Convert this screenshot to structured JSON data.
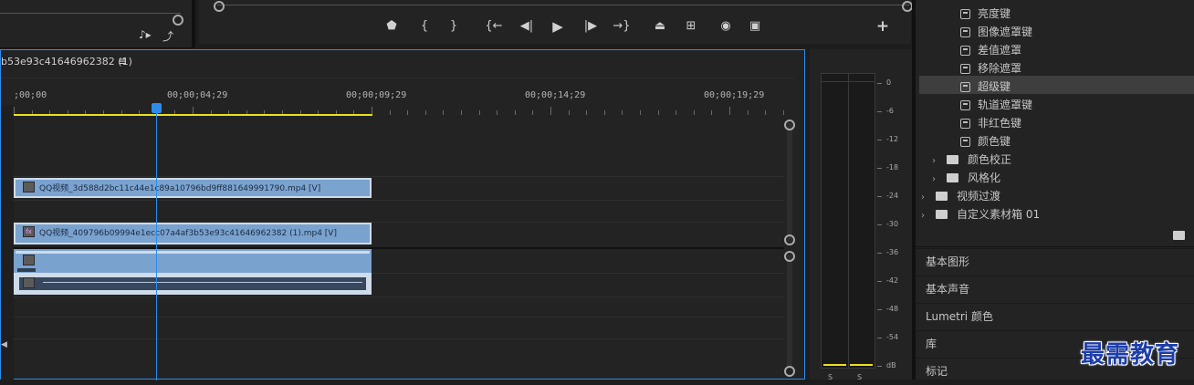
{
  "source_panel": {
    "icons": [
      "insert-icon",
      "export-frame-icon"
    ]
  },
  "program_monitor": {
    "controls": [
      {
        "name": "add-marker-button",
        "glyph": "⬟"
      },
      {
        "name": "mark-in-button",
        "glyph": "{"
      },
      {
        "name": "mark-out-button",
        "glyph": "}"
      },
      {
        "name": "go-to-in-button",
        "glyph": "{←"
      },
      {
        "name": "step-back-button",
        "glyph": "◀|"
      },
      {
        "name": "play-button",
        "glyph": "▶"
      },
      {
        "name": "step-forward-button",
        "glyph": "|▶"
      },
      {
        "name": "go-to-out-button",
        "glyph": "→}"
      },
      {
        "name": "lift-button",
        "glyph": "⏏"
      },
      {
        "name": "extract-button",
        "glyph": "⊞"
      },
      {
        "name": "export-frame-button",
        "glyph": "◉"
      },
      {
        "name": "compare-view-button",
        "glyph": "▣"
      },
      {
        "name": "button-editor-button",
        "glyph": "+"
      }
    ]
  },
  "timeline": {
    "sequence_name": "b53e93c41646962382 (1)",
    "menu_glyph": "≡",
    "ruler_labels": [
      ";00;00",
      "00;00;04;29",
      "00;00;09;29",
      "00;00;14;29",
      "00;00;19;29"
    ],
    "clips": [
      {
        "label": "QQ视频_3d588d2bc11c44e1c89a10796bd9ff881649991790.mp4 [V]",
        "fx": ""
      },
      {
        "label": "QQ视频_409796b09994e1ecc07a4af3b53e93c41646962382 (1).mp4 [V]",
        "fx": "fx"
      }
    ]
  },
  "audio_meter": {
    "scale": [
      "0",
      "-6",
      "-12",
      "-18",
      "-24",
      "-30",
      "-36",
      "-42",
      "-48",
      "-54",
      "dB"
    ],
    "channels": [
      "S",
      "S"
    ]
  },
  "effects_panel": {
    "items": [
      {
        "label": "亮度键",
        "type": "preset"
      },
      {
        "label": "图像遮罩键",
        "type": "preset"
      },
      {
        "label": "差值遮罩",
        "type": "preset"
      },
      {
        "label": "移除遮罩",
        "type": "preset"
      },
      {
        "label": "超级键",
        "type": "preset",
        "selected": true
      },
      {
        "label": "轨道遮罩键",
        "type": "preset"
      },
      {
        "label": "非红色键",
        "type": "preset"
      },
      {
        "label": "颜色键",
        "type": "preset"
      },
      {
        "label": "颜色校正",
        "type": "folder"
      },
      {
        "label": "风格化",
        "type": "folder"
      },
      {
        "label": "视频过渡",
        "type": "folder"
      },
      {
        "label": "自定义素材箱 01",
        "type": "folder"
      }
    ],
    "sections": [
      "基本图形",
      "基本声音",
      "Lumetri 颜色",
      "库",
      "标记"
    ]
  },
  "watermark": "最需教育",
  "colors": {
    "accent_blue": "#2d8ceb",
    "clip_blue": "#7aa2cf",
    "work_area_yellow": "#e8e21a",
    "selected_row": "#3e3e3e",
    "watermark_blue": "#1d3da8"
  }
}
